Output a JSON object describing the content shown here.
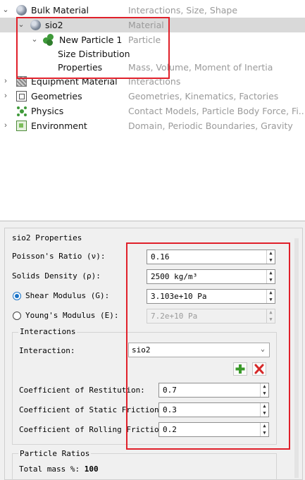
{
  "tree": {
    "rows": [
      {
        "label": "Bulk Material",
        "desc": "Interactions, Size, Shape"
      },
      {
        "label": "sio2",
        "desc": "Material"
      },
      {
        "label": "New Particle 1",
        "desc": "Particle"
      },
      {
        "label": "Size Distribution",
        "desc": ""
      },
      {
        "label": "Properties",
        "desc": "Mass, Volume, Moment of Inertia"
      },
      {
        "label": "Equipment Material",
        "desc": "Interactions"
      },
      {
        "label": "Geometries",
        "desc": "Geometries, Kinematics, Factories"
      },
      {
        "label": "Physics",
        "desc": "Contact Models, Particle Body Force, Fi..."
      },
      {
        "label": "Environment",
        "desc": "Domain, Periodic Boundaries, Gravity"
      }
    ]
  },
  "properties": {
    "title": "sio2 Properties",
    "poisson": {
      "label": "Poisson's Ratio (ν):",
      "value": "0.16"
    },
    "density": {
      "label": "Solids Density (ρ):",
      "value": "2500 kg/m³"
    },
    "shear": {
      "label": "Shear Modulus (G):",
      "value": "3.103e+10 Pa",
      "selected": true
    },
    "youngs": {
      "label": "Young's Modulus (E):",
      "value": "7.2e+10 Pa",
      "selected": false
    },
    "interactions": {
      "title": "Interactions",
      "interaction_label": "Interaction:",
      "interaction_value": "sio2",
      "restitution": {
        "label": "Coefficient of Restitution:",
        "value": "0.7"
      },
      "static_friction": {
        "label": "Coefficient of Static Friction:",
        "value": "0.3"
      },
      "rolling_friction": {
        "label": "Coefficient of Rolling Friction:",
        "value": "0.2"
      }
    },
    "ratios": {
      "title": "Particle Ratios",
      "total_mass_label": "Total mass %:",
      "total_mass_value": "100"
    }
  },
  "colors": {
    "highlight": "#e0202a",
    "selected_row": "#d9d9d9",
    "add": "#3a9a2a",
    "remove": "#d62828"
  }
}
